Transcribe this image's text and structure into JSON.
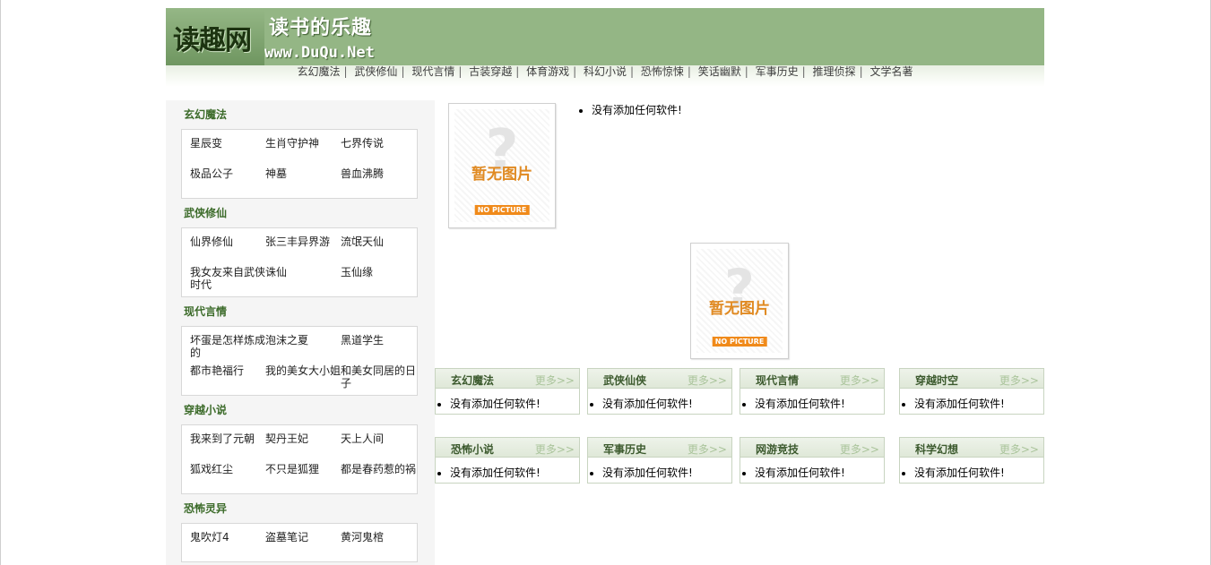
{
  "header": {
    "logo_text": "读趣网",
    "slogan": "读书的乐趣",
    "url": "www.DuQu.Net"
  },
  "nav": [
    "玄幻魔法",
    "武侠修仙",
    "现代言情",
    "古装穿越",
    "体育游戏",
    "科幻小说",
    "恐怖惊悚",
    "笑话幽默",
    "军事历史",
    "推理侦探",
    "文学名著"
  ],
  "sidebar": [
    {
      "title": "玄幻魔法",
      "items": [
        "星辰变",
        "生肖守护神",
        "七界传说",
        "极品公子",
        "神墓",
        "兽血沸腾"
      ]
    },
    {
      "title": "武侠修仙",
      "items": [
        "仙界修仙",
        "张三丰异界游",
        "流氓天仙",
        "我女友来自武侠时代",
        "诛仙",
        "玉仙缘"
      ]
    },
    {
      "title": "现代言情",
      "items": [
        "坏蛋是怎样炼成的",
        "泡沫之夏",
        "黑道学生",
        "都市艳福行",
        "我的美女大小姐",
        "和美女同居的日子"
      ]
    },
    {
      "title": "穿越小说",
      "items": [
        "我来到了元朝",
        "契丹王妃",
        "天上人间",
        "狐戏红尘",
        "不只是狐狸",
        "都是春药惹的祸"
      ]
    },
    {
      "title": "恐怖灵异",
      "items": [
        "鬼吹灯4",
        "盗墓笔记",
        "黄河鬼棺"
      ]
    }
  ],
  "main": {
    "no_picture_cn": "暂无图片",
    "no_picture_en": "NO PICTURE",
    "empty_text": "没有添加任何软件!",
    "more_label": "更多>>",
    "boxes": [
      {
        "title": "玄幻魔法",
        "empty": "没有添加任何软件!"
      },
      {
        "title": "武侠仙侠",
        "empty": "没有添加任何软件!"
      },
      {
        "title": "现代言情",
        "empty": "没有添加任何软件!"
      },
      {
        "title": "穿越时空",
        "empty": "没有添加任何软件!"
      },
      {
        "title": "恐怖小说",
        "empty": "没有添加任何软件!"
      },
      {
        "title": "军事历史",
        "empty": "没有添加任何软件!"
      },
      {
        "title": "网游竞技",
        "empty": "没有添加任何软件!"
      },
      {
        "title": "科学幻想",
        "empty": "没有添加任何软件!"
      }
    ]
  },
  "colors": {
    "header_green": "#94b685",
    "title_green": "#3c6b2a",
    "no_picture_orange": "#f08a1a"
  }
}
